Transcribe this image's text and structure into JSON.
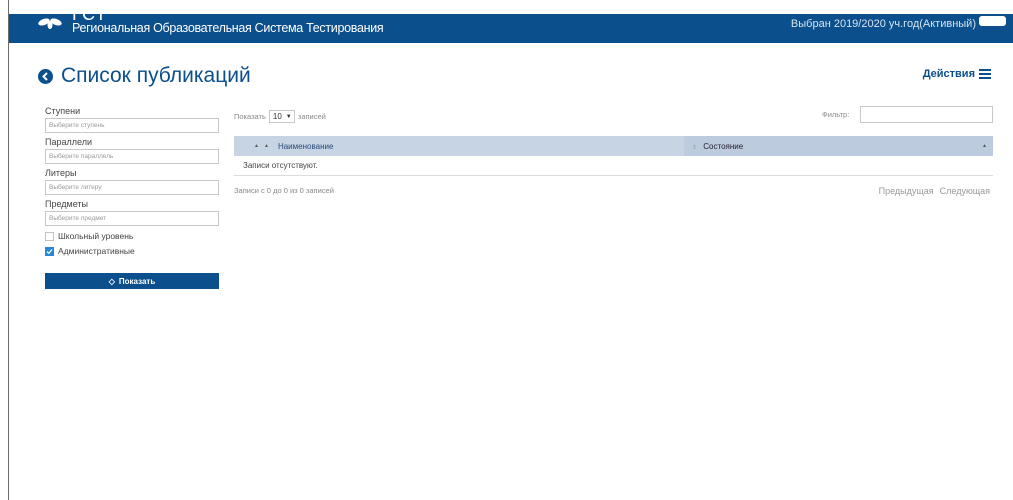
{
  "header": {
    "title": "ГСТ",
    "subtitle": "Региональная Образовательная Система Тестирования",
    "school_year": "Выбран 2019/2020 уч.год(Активный)"
  },
  "page": {
    "title": "Список публикаций",
    "actions_label": "Действия"
  },
  "filters": {
    "steps_label": "Ступени",
    "steps_placeholder": "Выберите ступень",
    "parallels_label": "Параллели",
    "parallels_placeholder": "Выберите параллель",
    "letters_label": "Литеры",
    "letters_placeholder": "Выберите литеру",
    "subjects_label": "Предметы",
    "subjects_placeholder": "Выберите предмет",
    "school_level_label": "Школьный уровень",
    "school_level_checked": false,
    "administrative_label": "Административные",
    "administrative_checked": true,
    "show_button": "Показать"
  },
  "table": {
    "show_prefix": "Показать",
    "page_size": "10",
    "show_suffix": "записей",
    "filter_label": "Фильтр:",
    "columns": [
      "Наименование",
      "Состояние"
    ],
    "empty_text": "Записи отсутствуют.",
    "info": "Записи с 0 до 0 из 0 записей",
    "prev": "Предыдущая",
    "next": "Следующая"
  },
  "colors": {
    "brand": "#0b4f8d",
    "table_header": "#c6d4e4",
    "checkbox_on": "#2a86d8"
  }
}
